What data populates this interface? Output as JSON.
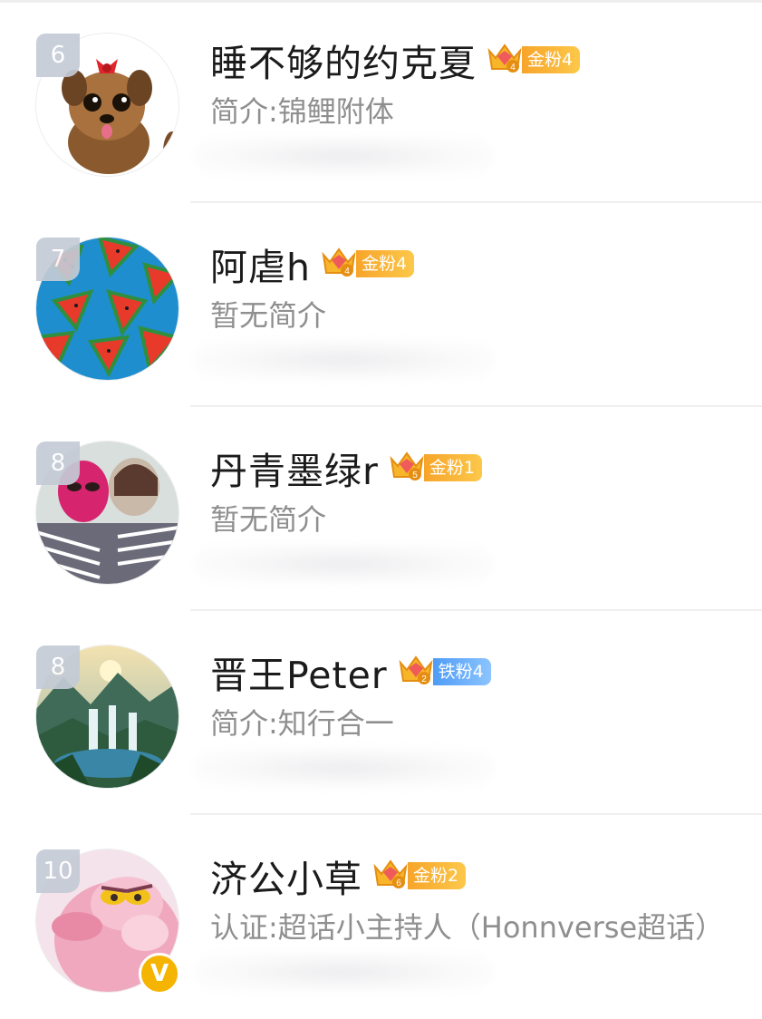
{
  "colors": {
    "name": "#1b1b1b",
    "bio": "#8f8f8f",
    "rank_bg": "#c4cbd6",
    "gold_badge": "#f7a52a",
    "iron_badge": "#4f9cf6",
    "verify_badge": "#f5b400"
  },
  "fans": [
    {
      "rank": "6",
      "name": "睡不够的约克夏",
      "crown_level": "4",
      "fan_badge": "金粉4",
      "badge_type": "gold",
      "bio": "简介:锦鲤附体",
      "avatar": "yorkie-dog-avatar"
    },
    {
      "rank": "7",
      "name": "阿虐h",
      "crown_level": "4",
      "fan_badge": "金粉4",
      "badge_type": "gold",
      "bio": "暂无简介",
      "avatar": "watermelon-avatar"
    },
    {
      "rank": "8",
      "name": "丹青墨绿r",
      "crown_level": "5",
      "fan_badge": "金粉1",
      "badge_type": "gold",
      "bio": "暂无简介",
      "avatar": "couple-photo-avatar"
    },
    {
      "rank": "8",
      "name": "晋王Peter",
      "crown_level": "2",
      "fan_badge": "铁粉4",
      "badge_type": "iron",
      "bio": "简介:知行合一",
      "avatar": "waterfall-landscape-avatar"
    },
    {
      "rank": "10",
      "name": "济公小草",
      "crown_level": "6",
      "fan_badge": "金粉2",
      "badge_type": "gold",
      "bio": "认证:超话小主持人（Honnverse超话）",
      "avatar": "pink-cartoon-avatar",
      "verified": true
    }
  ]
}
